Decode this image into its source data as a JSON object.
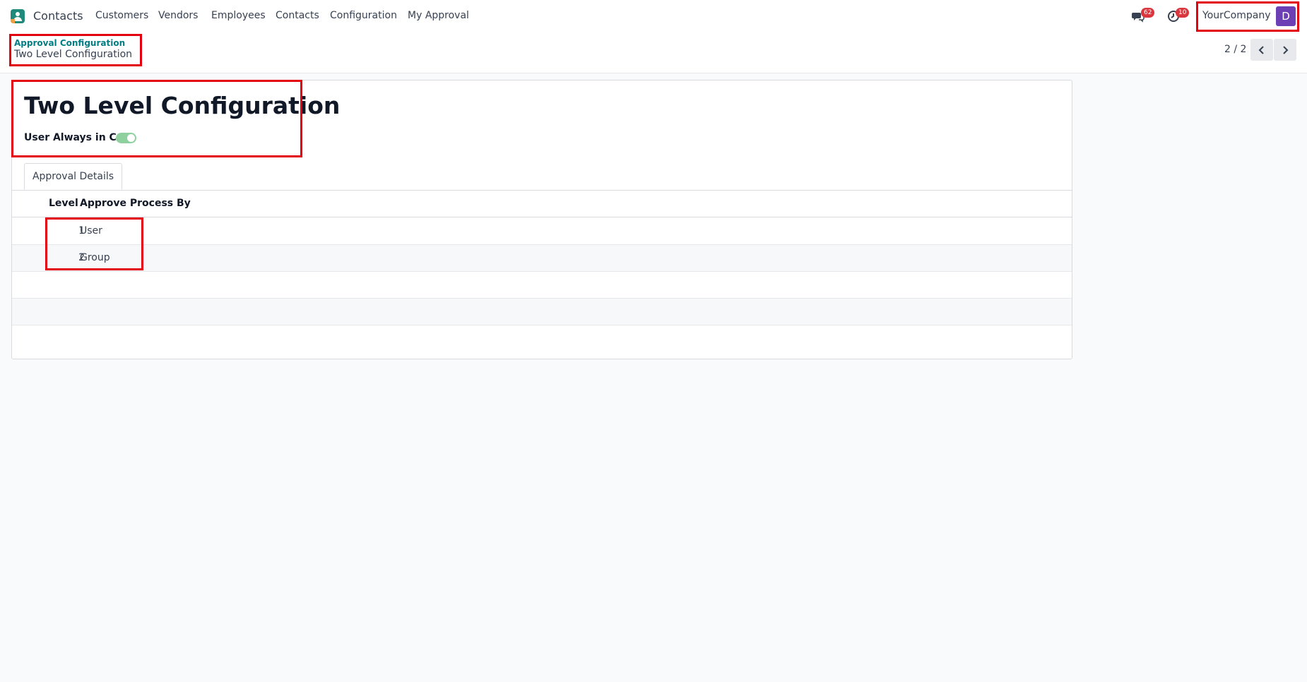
{
  "navbar": {
    "app_icon": "contacts-app-icon",
    "app_name": "Contacts",
    "menu": [
      "Customers",
      "Vendors",
      "Employees",
      "Contacts",
      "Configuration",
      "My Approval"
    ],
    "messages_icon": "chat-bubbles-icon",
    "messages_count": "62",
    "activities_icon": "clock-icon",
    "activities_count": "10",
    "company": "YourCompany",
    "avatar_letter": "D",
    "avatar_color": "#6c3fb5"
  },
  "breadcrumb": {
    "parent": "Approval Configuration",
    "current": "Two Level Configuration"
  },
  "pager": {
    "value": "2 / 2",
    "prev_icon": "chevron-left-icon",
    "next_icon": "chevron-right-icon"
  },
  "form": {
    "title": "Two Level Configuration",
    "user_cc_label": "User Always in CC",
    "user_cc_enabled": true
  },
  "tabs": [
    {
      "label": "Approval Details",
      "active": true
    }
  ],
  "table": {
    "columns": [
      "Level",
      "Approve Process By"
    ],
    "rows": [
      {
        "level": "1",
        "by": "User"
      },
      {
        "level": "2",
        "by": "Group"
      }
    ]
  },
  "colors": {
    "accent": "#017e84",
    "highlight": "#e3000f",
    "badge": "#d9363e",
    "toggle_on": "#8fd19e"
  }
}
